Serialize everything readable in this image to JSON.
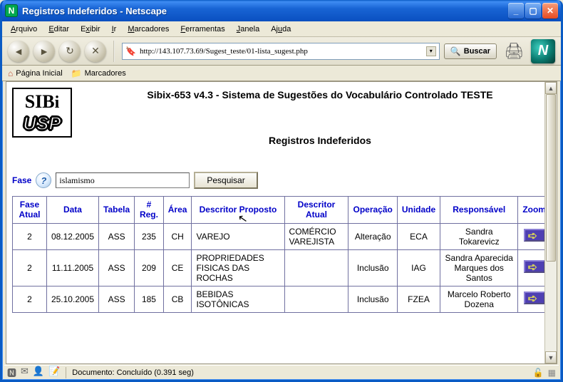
{
  "window": {
    "title": "Registros Indeferidos - Netscape"
  },
  "menu": {
    "arquivo": "Arquivo",
    "editar": "Editar",
    "exibir": "Exibir",
    "ir": "Ir",
    "marcadores": "Marcadores",
    "ferramentas": "Ferramentas",
    "janela": "Janela",
    "ajuda": "Ajuda"
  },
  "toolbar": {
    "url": "http://143.107.73.69/Sugest_teste/01-lista_sugest.php",
    "search_label": "Buscar"
  },
  "bookmarks": {
    "home": "Página Inicial",
    "marcadores": "Marcadores"
  },
  "page": {
    "system_title": "Sibix-653 v4.3 - Sistema de Sugestões do Vocabulário Controlado TESTE",
    "subtitle": "Registros Indeferidos",
    "logo_top": "SIBi",
    "logo_bottom": "USP",
    "fase_label": "Fase",
    "search_value": "islamismo",
    "search_button": "Pesquisar"
  },
  "table": {
    "headers": {
      "fase": "Fase Atual",
      "data": "Data",
      "tabela": "Tabela",
      "reg": "# Reg.",
      "area": "Área",
      "proposto": "Descritor Proposto",
      "atual": "Descritor Atual",
      "operacao": "Operação",
      "unidade": "Unidade",
      "responsavel": "Responsável",
      "zoom": "Zoom"
    },
    "rows": [
      {
        "fase": "2",
        "data": "08.12.2005",
        "tabela": "ASS",
        "reg": "235",
        "area": "CH",
        "proposto": "VAREJO",
        "atual": "COMÉRCIO VAREJISTA",
        "operacao": "Alteração",
        "unidade": "ECA",
        "responsavel": "Sandra Tokarevicz"
      },
      {
        "fase": "2",
        "data": "11.11.2005",
        "tabela": "ASS",
        "reg": "209",
        "area": "CE",
        "proposto": "PROPRIEDADES FISICAS DAS ROCHAS",
        "atual": "",
        "operacao": "Inclusão",
        "unidade": "IAG",
        "responsavel": "Sandra Aparecida Marques dos Santos"
      },
      {
        "fase": "2",
        "data": "25.10.2005",
        "tabela": "ASS",
        "reg": "185",
        "area": "CB",
        "proposto": "BEBIDAS ISOTÔNICAS",
        "atual": "",
        "operacao": "Inclusão",
        "unidade": "FZEA",
        "responsavel": "Marcelo Roberto Dozena"
      }
    ]
  },
  "status": {
    "text": "Documento: Concluído (0.391 seg)"
  }
}
